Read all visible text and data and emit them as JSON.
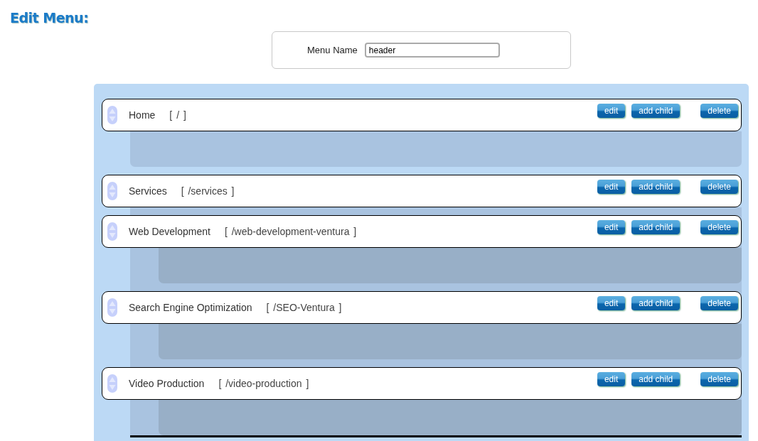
{
  "title": "Edit Menu:",
  "menu_name": {
    "label": "Menu Name",
    "value": "header"
  },
  "items": [
    {
      "name": "Home",
      "path": "[ / ]",
      "buttons": [
        "edit",
        "add child",
        "delete"
      ]
    },
    {
      "name": "Services",
      "path": "[ /services ]",
      "buttons": [
        "edit",
        "add child",
        "delete"
      ],
      "children": [
        {
          "name": "Web Development",
          "path": "[ /web-development-ventura ]",
          "buttons": [
            "edit",
            "add child",
            "delete"
          ]
        },
        {
          "name": "Search Engine Optimization",
          "path": "[ /SEO-Ventura ]",
          "buttons": [
            "edit",
            "add child",
            "delete"
          ]
        },
        {
          "name": "Video Production",
          "path": "[ /video-production ]",
          "buttons": [
            "edit",
            "add child",
            "delete"
          ]
        }
      ]
    }
  ]
}
